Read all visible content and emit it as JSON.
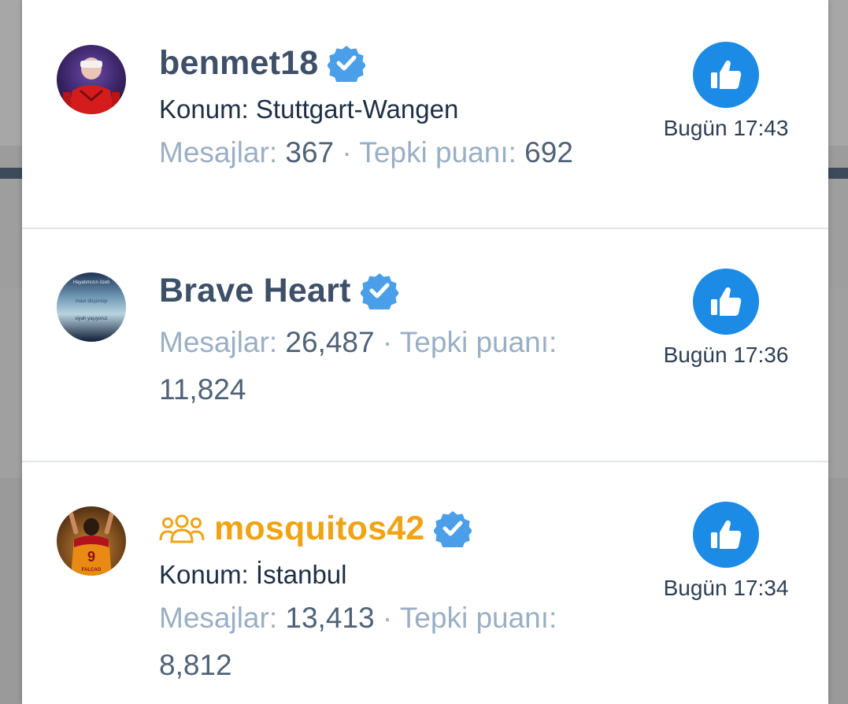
{
  "reactions": [
    {
      "username": "benmet18",
      "is_staff": false,
      "verified": true,
      "location_label": "Konum:",
      "location": "Stuttgart-Wangen",
      "messages_label": "Mesajlar:",
      "messages": "367",
      "separator": "·",
      "reaction_label": "Tepki puanı:",
      "reaction_score": "692",
      "time": "Bugün 17:43",
      "reaction_icon": "thumbs-up-icon"
    },
    {
      "username": "Brave Heart",
      "is_staff": false,
      "verified": true,
      "location_label": "",
      "location": "",
      "messages_label": "Mesajlar:",
      "messages": "26,487",
      "separator": "·",
      "reaction_label": "Tepki puanı:",
      "reaction_score": "11,824",
      "time": "Bugün 17:36",
      "reaction_icon": "thumbs-up-icon",
      "avatar_text": [
        "Hayatımızın özeti",
        "mavi düşünüp",
        "siyah yaşıyoruz"
      ]
    },
    {
      "username": "mosquitos42",
      "is_staff": true,
      "verified": true,
      "location_label": "Konum:",
      "location": "İstanbul",
      "messages_label": "Mesajlar:",
      "messages": "13,413",
      "separator": "·",
      "reaction_label": "Tepki puanı:",
      "reaction_score": "8,812",
      "time": "Bugün 17:34",
      "reaction_icon": "thumbs-up-icon",
      "avatar_text": [
        "9",
        "FALCAO"
      ]
    }
  ],
  "colors": {
    "username": "#3e5068",
    "staff_username": "#f0a313",
    "verified_badge": "#4a9fe8",
    "like_button": "#1b8be6",
    "muted_text": "#9aafc4"
  }
}
